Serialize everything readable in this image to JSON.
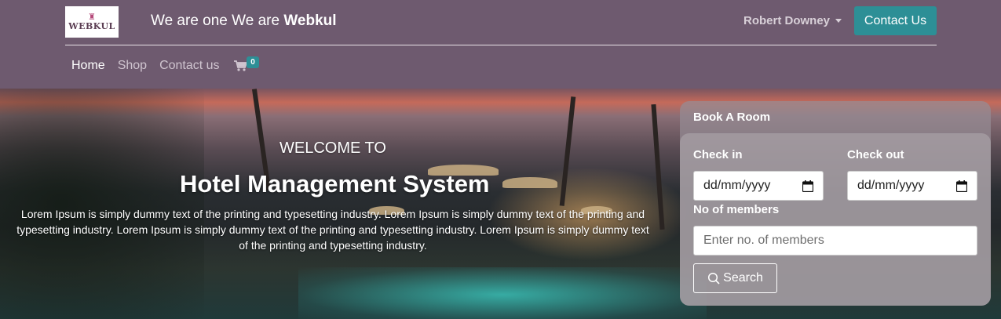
{
  "header": {
    "logo_text": "WEBKUL",
    "tagline_prefix": "We are one We are ",
    "tagline_brand": "Webkul",
    "user_name": "Robert Downey",
    "contact_button": "Contact Us"
  },
  "nav": {
    "items": [
      {
        "label": "Home",
        "active": true
      },
      {
        "label": "Shop",
        "active": false
      },
      {
        "label": "Contact us",
        "active": false
      }
    ],
    "cart_count": "0"
  },
  "hero": {
    "welcome": "WELCOME TO",
    "title": "Hotel Management System",
    "description": "Lorem Ipsum is simply dummy text of the printing and typesetting industry. Lorem Ipsum is simply dummy text of the printing and typesetting industry. Lorem Ipsum is simply dummy text of the printing and typesetting industry. Lorem Ipsum is simply dummy text of the printing and typesetting industry."
  },
  "booking": {
    "title": "Book A Room",
    "check_in_label": "Check in",
    "check_in_value": "dd/mm/yyyy",
    "check_out_label": "Check out",
    "check_out_value": "dd/mm/yyyy",
    "members_label": "No of members",
    "members_placeholder": "Enter no. of members",
    "search_button": "Search"
  },
  "colors": {
    "header_bg": "#6e5a6f",
    "accent": "#2d8f96"
  }
}
